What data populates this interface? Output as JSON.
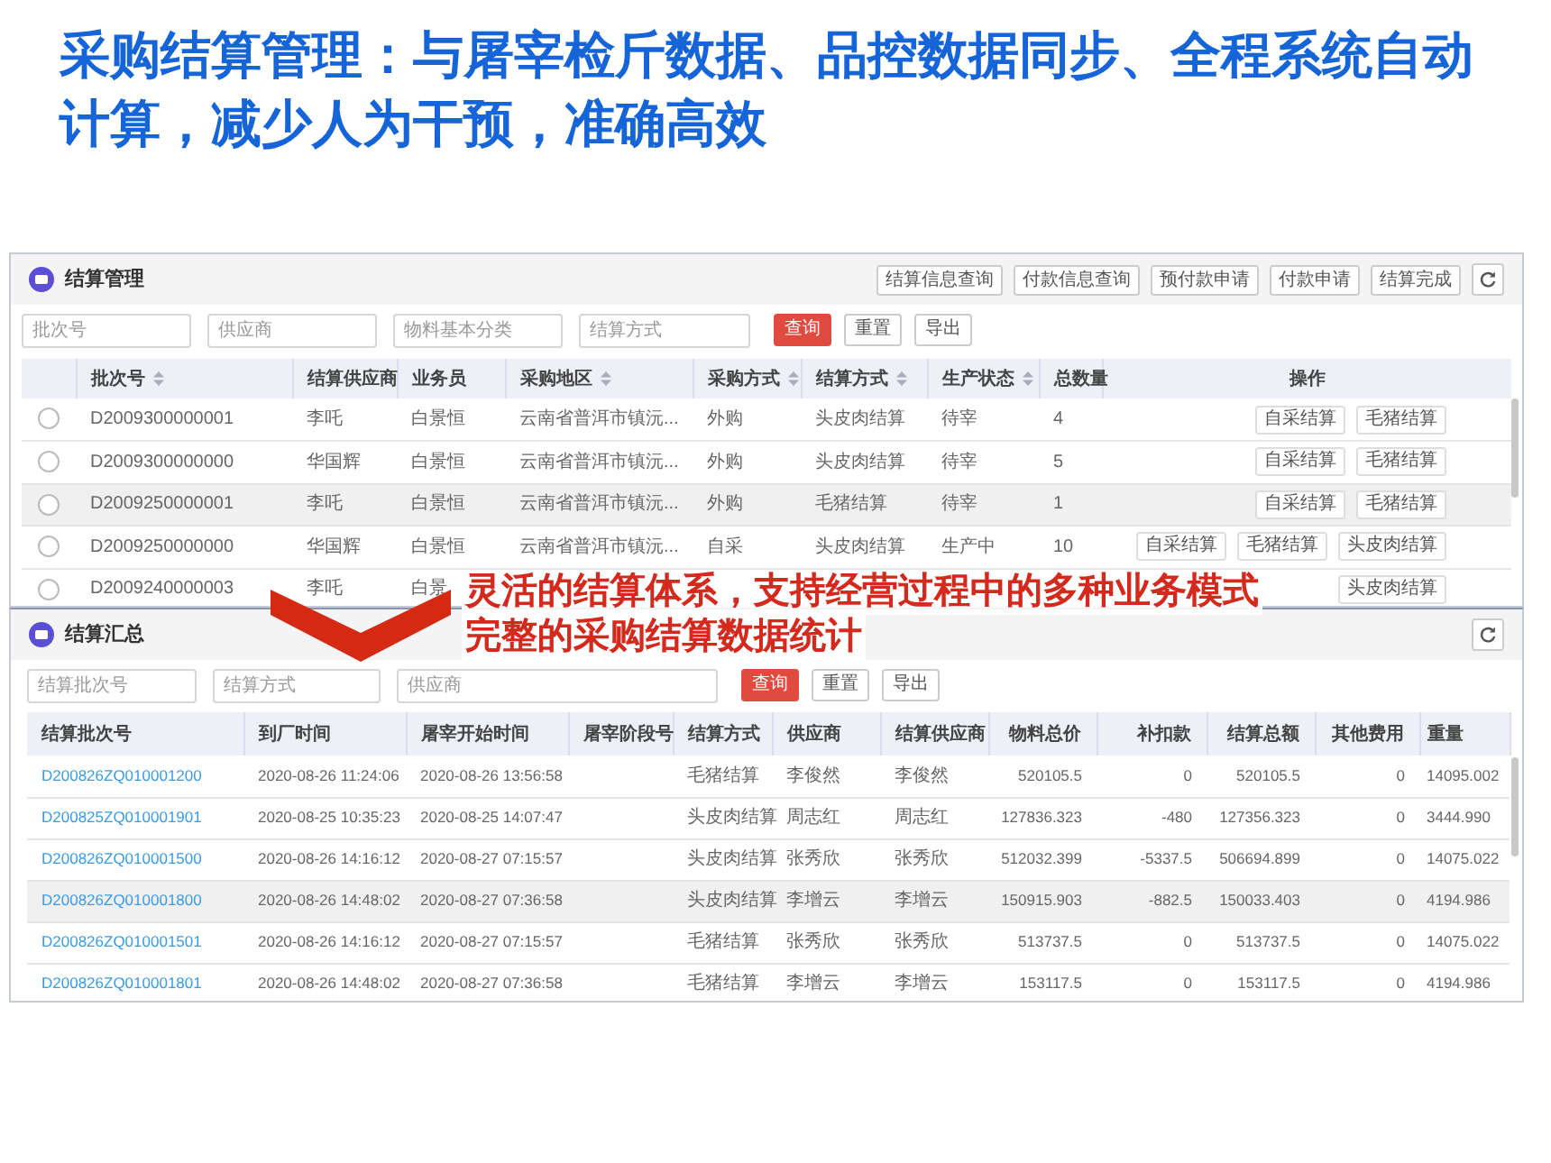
{
  "title": "采购结算管理：与屠宰检斤数据、品控数据同步、全程系统自动计算，减少人为干预，准确高效",
  "settlement_panel": {
    "title": "结算管理",
    "action_buttons": [
      "结算信息查询",
      "付款信息查询",
      "预付款申请",
      "付款申请",
      "结算完成"
    ],
    "filters": [
      {
        "placeholder": "批次号"
      },
      {
        "placeholder": "供应商"
      },
      {
        "placeholder": "物料基本分类"
      },
      {
        "placeholder": "结算方式"
      }
    ],
    "filter_buttons": [
      {
        "label": "查询",
        "kind": "primary"
      },
      {
        "label": "重置",
        "kind": "default"
      },
      {
        "label": "导出",
        "kind": "default"
      }
    ],
    "columns": [
      {
        "label": "批次号",
        "sortable": true
      },
      {
        "label": "结算供应商"
      },
      {
        "label": "业务员"
      },
      {
        "label": "采购地区",
        "sortable": true
      },
      {
        "label": "采购方式",
        "sortable": true
      },
      {
        "label": "结算方式",
        "sortable": true
      },
      {
        "label": "生产状态",
        "sortable": true
      },
      {
        "label": "总数量"
      },
      {
        "label": "操作"
      }
    ],
    "rows": [
      {
        "selected": false,
        "hovered": false,
        "cells": [
          "D2009300000001",
          "李吒",
          "白景恒",
          "云南省普洱市镇沅...",
          "外购",
          "头皮肉结算",
          "待宰",
          "4"
        ],
        "actions": [
          "自采结算",
          "毛猪结算"
        ]
      },
      {
        "selected": false,
        "hovered": false,
        "cells": [
          "D2009300000000",
          "华国辉",
          "白景恒",
          "云南省普洱市镇沅...",
          "外购",
          "头皮肉结算",
          "待宰",
          "5"
        ],
        "actions": [
          "自采结算",
          "毛猪结算"
        ]
      },
      {
        "selected": false,
        "hovered": true,
        "cells": [
          "D2009250000001",
          "李吒",
          "白景恒",
          "云南省普洱市镇沅...",
          "外购",
          "毛猪结算",
          "待宰",
          "1"
        ],
        "actions": [
          "自采结算",
          "毛猪结算"
        ]
      },
      {
        "selected": false,
        "hovered": false,
        "cells": [
          "D2009250000000",
          "华国辉",
          "白景恒",
          "云南省普洱市镇沅...",
          "自采",
          "头皮肉结算",
          "生产中",
          "10"
        ],
        "actions": [
          "自采结算",
          "毛猪结算",
          "头皮肉结算"
        ]
      },
      {
        "selected": false,
        "hovered": false,
        "cells": [
          "D2009240000003",
          "李吒",
          "白景"
        ],
        "actions": [
          "头皮肉结算"
        ]
      }
    ]
  },
  "summary_panel": {
    "title": "结算汇总",
    "filters": [
      {
        "placeholder": "结算批次号"
      },
      {
        "placeholder": "结算方式"
      },
      {
        "placeholder": "供应商"
      }
    ],
    "filter_buttons": [
      {
        "label": "查询",
        "kind": "primary"
      },
      {
        "label": "重置",
        "kind": "default"
      },
      {
        "label": "导出",
        "kind": "default"
      }
    ],
    "columns": [
      "结算批次号",
      "到厂时间",
      "屠宰开始时间",
      "屠宰阶段号",
      "结算方式",
      "供应商",
      "结算供应商",
      "物料总价",
      "补扣款",
      "结算总额",
      "其他费用",
      "重量"
    ],
    "rows": [
      {
        "hovered": false,
        "cells": [
          "D200826ZQ010001200",
          "2020-08-26 11:24:06",
          "2020-08-26 13:56:58",
          "",
          "毛猪结算",
          "李俊然",
          "李俊然",
          "520105.5",
          "0",
          "520105.5",
          "0",
          "14095.002"
        ]
      },
      {
        "hovered": false,
        "cells": [
          "D200825ZQ010001901",
          "2020-08-25 10:35:23",
          "2020-08-25 14:07:47",
          "",
          "头皮肉结算",
          "周志红",
          "周志红",
          "127836.323",
          "-480",
          "127356.323",
          "0",
          "3444.990"
        ]
      },
      {
        "hovered": false,
        "cells": [
          "D200826ZQ010001500",
          "2020-08-26 14:16:12",
          "2020-08-27 07:15:57",
          "",
          "头皮肉结算",
          "张秀欣",
          "张秀欣",
          "512032.399",
          "-5337.5",
          "506694.899",
          "0",
          "14075.022"
        ]
      },
      {
        "hovered": true,
        "cells": [
          "D200826ZQ010001800",
          "2020-08-26 14:48:02",
          "2020-08-27 07:36:58",
          "",
          "头皮肉结算",
          "李增云",
          "李增云",
          "150915.903",
          "-882.5",
          "150033.403",
          "0",
          "4194.986"
        ]
      },
      {
        "hovered": false,
        "cells": [
          "D200826ZQ010001501",
          "2020-08-26 14:16:12",
          "2020-08-27 07:15:57",
          "",
          "毛猪结算",
          "张秀欣",
          "张秀欣",
          "513737.5",
          "0",
          "513737.5",
          "0",
          "14075.022"
        ]
      },
      {
        "hovered": false,
        "cells": [
          "D200826ZQ010001801",
          "2020-08-26 14:48:02",
          "2020-08-27 07:36:58",
          "",
          "毛猪结算",
          "李增云",
          "李增云",
          "153117.5",
          "0",
          "153117.5",
          "0",
          "4194.986"
        ]
      }
    ]
  },
  "callout": {
    "lines": [
      "灵活的结算体系，支持经营过程中的多种业务模式",
      "完整的采购结算数据统计"
    ]
  }
}
